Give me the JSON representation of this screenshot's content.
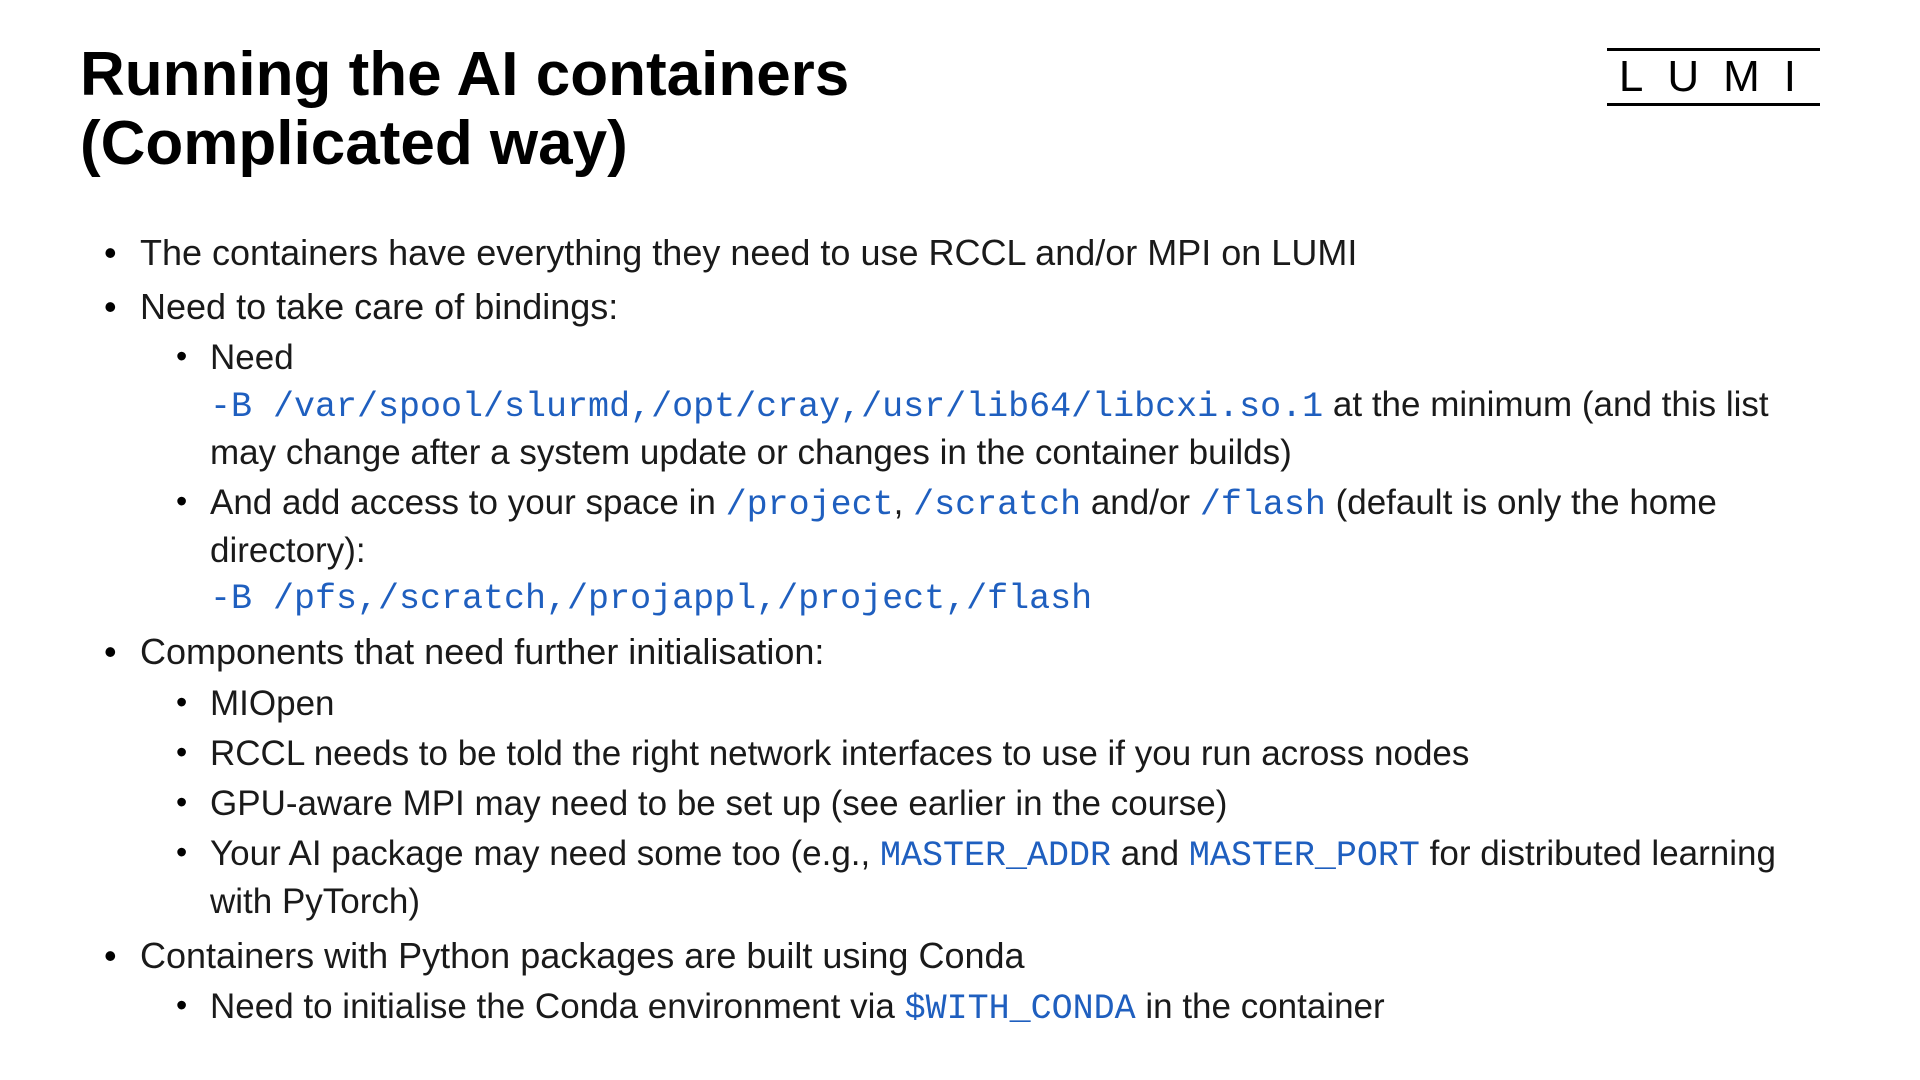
{
  "logo": "LUMI",
  "title_line1": "Running the AI containers",
  "title_line2": "(Complicated way)",
  "b1": "The containers have everything they need to use RCCL and/or MPI on LUMI",
  "b2": "Need to take care of bindings:",
  "b2s1_pre": "Need",
  "b2s1_code": "-B /var/spool/slurmd,/opt/cray,/usr/lib64/libcxi.so.1",
  "b2s1_post": " at the minimum (and this list may change after a system update or changes in the container builds)",
  "b2s2_a": "And add access to your space in ",
  "b2s2_c1": "/project",
  "b2s2_sep1": ", ",
  "b2s2_c2": "/scratch",
  "b2s2_mid": " and/or ",
  "b2s2_c3": "/flash",
  "b2s2_b": " (default is only the home directory):",
  "b2s2_code": "-B /pfs,/scratch,/projappl,/project,/flash",
  "b3": "Components that need further initialisation:",
  "b3s1": "MIOpen",
  "b3s2": "RCCL needs to be told the right network interfaces to use if you run across nodes",
  "b3s3": "GPU-aware MPI may need to be set up (see earlier in the course)",
  "b3s4_a": "Your AI package may need some too (e.g., ",
  "b3s4_c1": "MASTER_ADDR",
  "b3s4_mid": " and ",
  "b3s4_c2": "MASTER_PORT",
  "b3s4_b": " for distributed learning with PyTorch)",
  "b4": "Containers with Python packages are built using Conda",
  "b4s1_a": "Need to initialise the Conda environment via ",
  "b4s1_c": "$WITH_CONDA",
  "b4s1_b": " in the container"
}
